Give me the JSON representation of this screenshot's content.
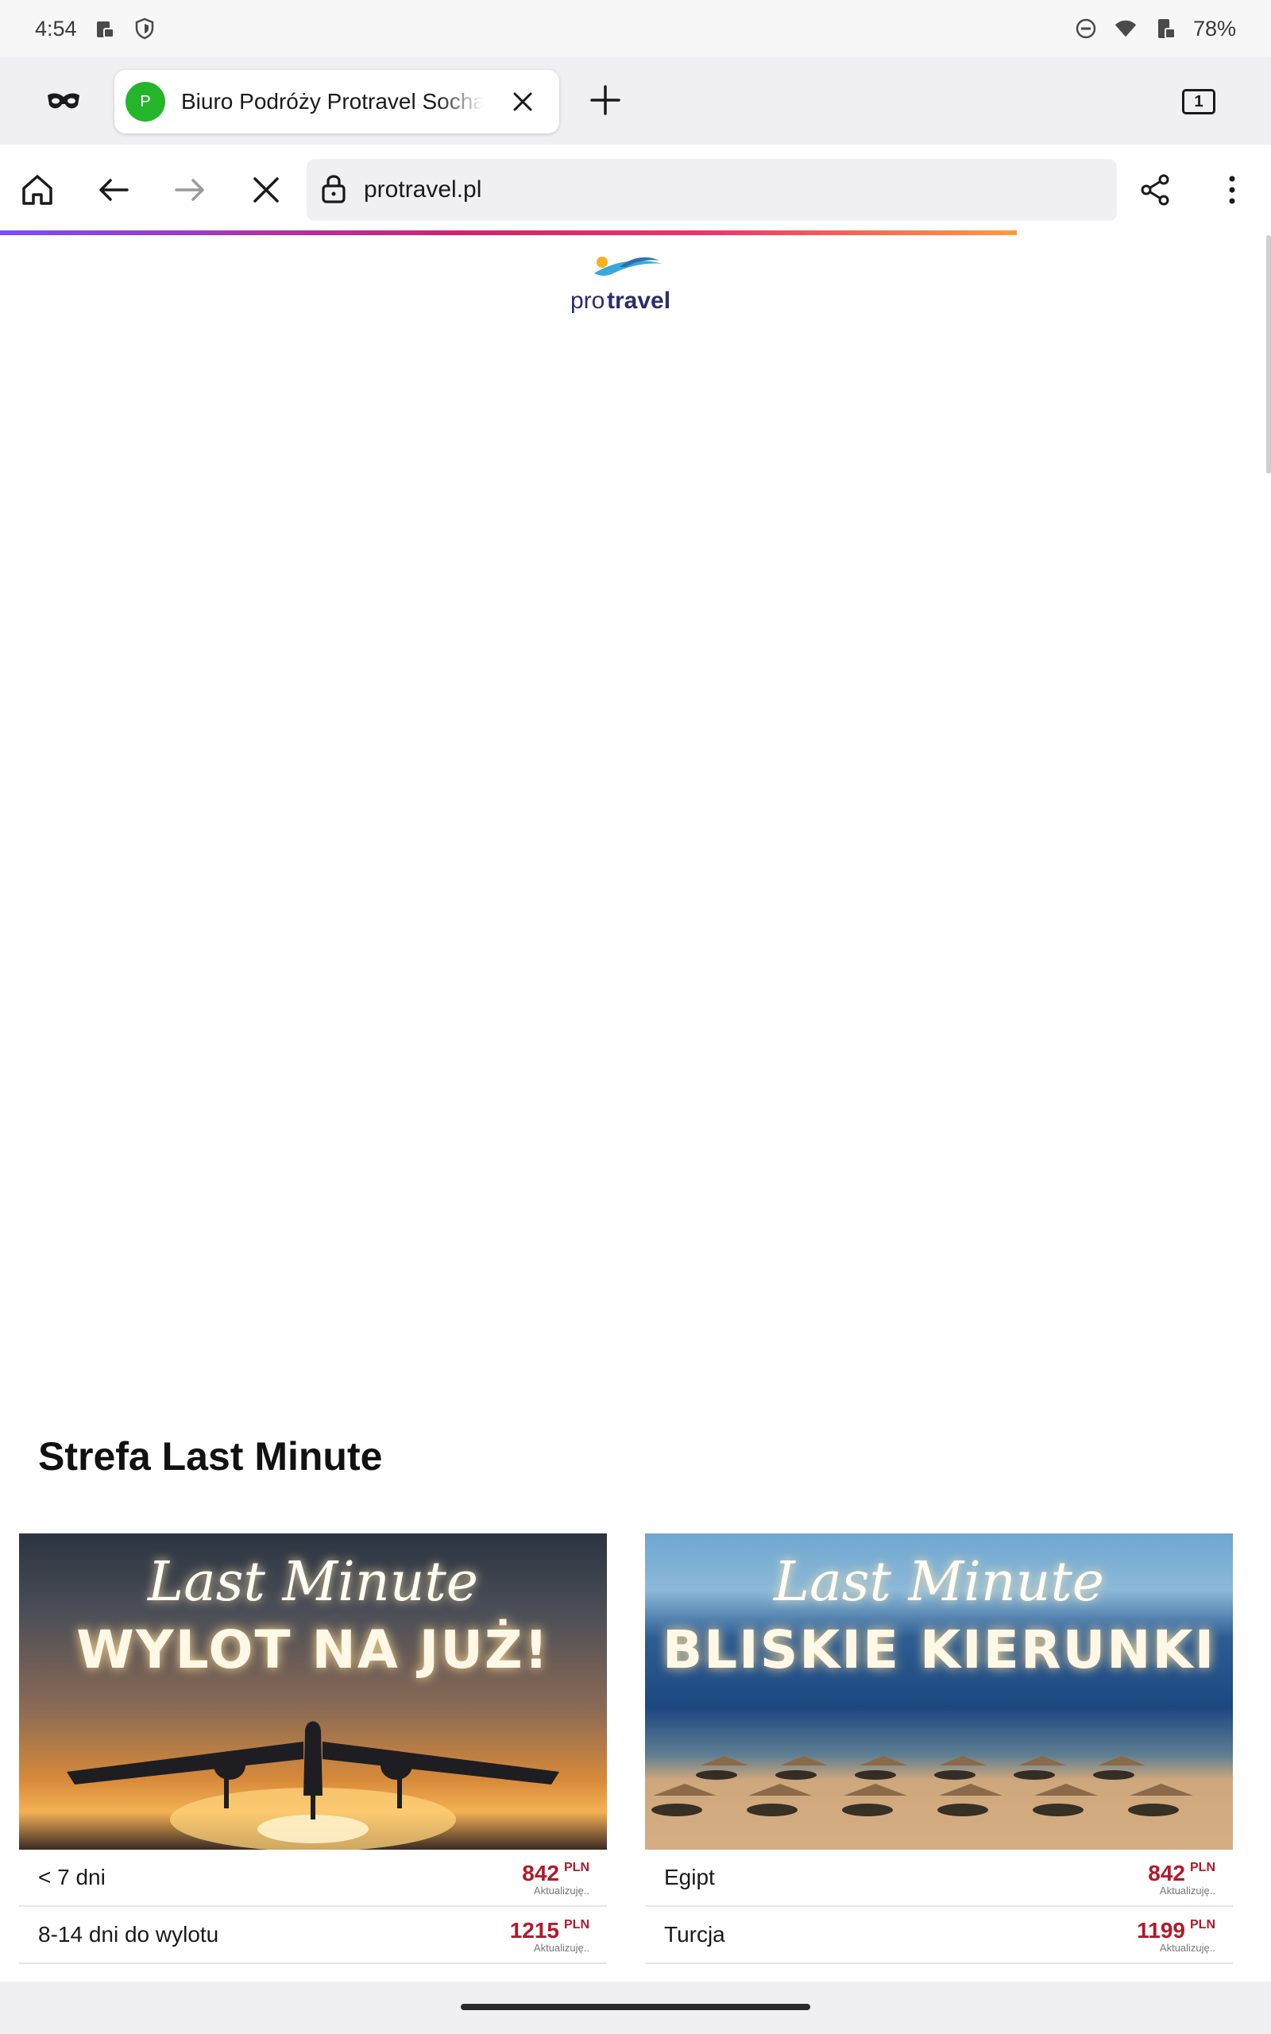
{
  "status_bar": {
    "time": "4:54",
    "battery": "78%"
  },
  "tab": {
    "favicon_letter": "P",
    "title": "Biuro Podróży Protravel Sochaczew"
  },
  "tab_count": "1",
  "address_bar": {
    "url": "protravel.pl"
  },
  "logo": {
    "pro": "pro",
    "travel": "travel"
  },
  "section": {
    "title": "Strefa Last Minute"
  },
  "cards": [
    {
      "script": "Last Minute",
      "headline": "WYLOT NA JUŻ!",
      "rows": [
        {
          "label": "< 7 dni",
          "price": "842",
          "currency": "PLN",
          "note": "Aktualizuję.."
        },
        {
          "label": "8-14 dni do wylotu",
          "price": "1215",
          "currency": "PLN",
          "note": "Aktualizuję.."
        }
      ]
    },
    {
      "script": "Last Minute",
      "headline": "BLISKIE KIERUNKI",
      "rows": [
        {
          "label": "Egipt",
          "price": "842",
          "currency": "PLN",
          "note": "Aktualizuję.."
        },
        {
          "label": "Turcja",
          "price": "1199",
          "currency": "PLN",
          "note": "Aktualizuję.."
        }
      ]
    }
  ],
  "colors": {
    "accent_green": "#24b52b",
    "price_red": "#b01a2a",
    "logo_navy": "#2c2c6e",
    "logo_sky": "#38a8dc"
  },
  "icons": [
    "private-mode-icon",
    "close-icon",
    "plus-icon",
    "home-icon",
    "back-arrow-icon",
    "forward-arrow-icon",
    "stop-loading-icon",
    "lock-icon",
    "share-icon",
    "more-vertical-icon"
  ]
}
